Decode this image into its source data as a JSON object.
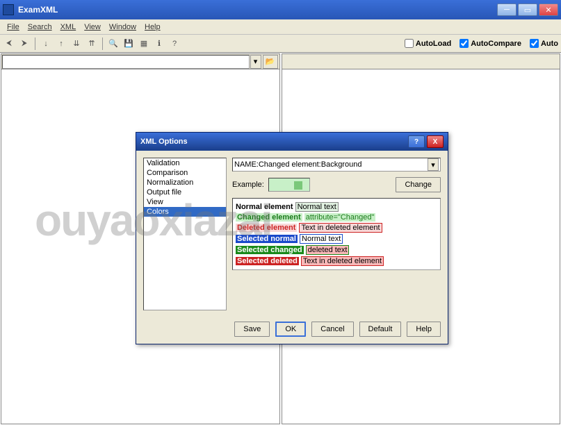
{
  "app": {
    "title": "ExamXML"
  },
  "menu": {
    "file": "File",
    "search": "Search",
    "xml": "XML",
    "view": "View",
    "window": "Window",
    "help": "Help"
  },
  "toolbar_checks": {
    "autoload": "AutoLoad",
    "autocompare": "AutoCompare",
    "auto3": "Auto"
  },
  "dialog": {
    "title": "XML Options",
    "tabs": [
      "Validation",
      "Comparison",
      "Normalization",
      "Output file",
      "View",
      "Colors"
    ],
    "selected_tab": "Colors",
    "combo_value": "NAME:Changed element:Background",
    "example_label": "Example:",
    "change_btn": "Change",
    "preview": {
      "normal_lbl": "Normal element",
      "normal_txt": "Normal text",
      "changed_lbl": "Changed element",
      "changed_attr": "attribute=\"Changed\"",
      "deleted_lbl": "Deleted element",
      "deleted_txt": "Text in deleted element",
      "selnorm_lbl": "Selected normal",
      "selnorm_txt": "Normal text",
      "selchg_lbl": "Selected changed",
      "selchg_txt": "deleted text",
      "seldel_lbl": "Selected deleted",
      "seldel_txt": "Text in deleted element"
    },
    "buttons": {
      "save": "Save",
      "ok": "OK",
      "cancel": "Cancel",
      "default": "Default",
      "help": "Help"
    }
  },
  "watermark": "ouyaoxiazai"
}
